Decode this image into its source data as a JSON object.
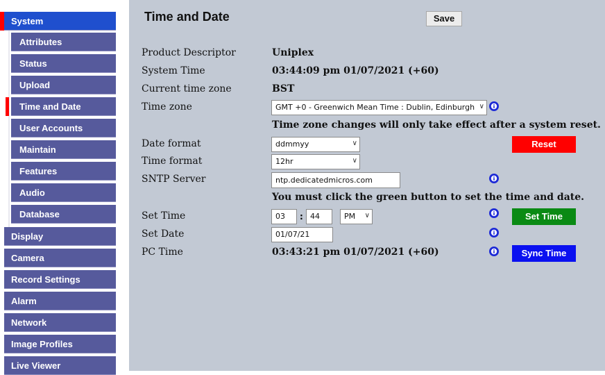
{
  "sidebar": {
    "items": [
      {
        "label": "System",
        "level": "top",
        "selected": true
      },
      {
        "label": "Attributes",
        "level": "sub"
      },
      {
        "label": "Status",
        "level": "sub"
      },
      {
        "label": "Upload",
        "level": "sub"
      },
      {
        "label": "Time and Date",
        "level": "sub",
        "selected": true
      },
      {
        "label": "User Accounts",
        "level": "sub"
      },
      {
        "label": "Maintain",
        "level": "sub"
      },
      {
        "label": "Features",
        "level": "sub"
      },
      {
        "label": "Audio",
        "level": "sub"
      },
      {
        "label": "Database",
        "level": "sub"
      },
      {
        "label": "Display",
        "level": "top"
      },
      {
        "label": "Camera",
        "level": "top"
      },
      {
        "label": "Record Settings",
        "level": "top"
      },
      {
        "label": "Alarm",
        "level": "top"
      },
      {
        "label": "Network",
        "level": "top"
      },
      {
        "label": "Image Profiles",
        "level": "top"
      },
      {
        "label": "Live Viewer",
        "level": "top"
      }
    ]
  },
  "header": {
    "title": "Time and Date",
    "save_label": "Save"
  },
  "form": {
    "product_descriptor_label": "Product Descriptor",
    "product_descriptor_value": "Uniplex",
    "system_time_label": "System Time",
    "system_time_value": "03:44:09 pm 01/07/2021 (+60)",
    "current_tz_label": "Current time zone",
    "current_tz_value": "BST",
    "tz_label": "Time zone",
    "tz_value": "GMT +0 - Greenwich Mean Time : Dublin, Edinburgh",
    "tz_note": "Time zone changes will only take effect after a system reset.",
    "date_format_label": "Date format",
    "date_format_value": "ddmmyy",
    "time_format_label": "Time format",
    "time_format_value": "12hr",
    "sntp_label": "SNTP Server",
    "sntp_value": "ntp.dedicatedmicros.com",
    "green_note": "You must click the green button to set the time and date.",
    "set_time_label": "Set Time",
    "set_time_hour": "03",
    "set_time_sep": ":",
    "set_time_minute": "44",
    "set_time_ampm": "PM",
    "set_date_label": "Set Date",
    "set_date_value": "01/07/21",
    "pc_time_label": "PC Time",
    "pc_time_value": "03:43:21 pm 01/07/2021 (+60)"
  },
  "buttons": {
    "reset_label": "Reset",
    "set_time_label": "Set Time",
    "sync_time_label": "Sync Time"
  },
  "colors": {
    "nav_bg": "#565a9c",
    "nav_selected": "#1f4fce",
    "selected_marker": "#ff0000",
    "content_bg": "#c2c9d4",
    "reset": "#ff0000",
    "set_time": "#0a8a14",
    "sync_time": "#0a10f0",
    "info_icon": "#1d2ad6"
  }
}
